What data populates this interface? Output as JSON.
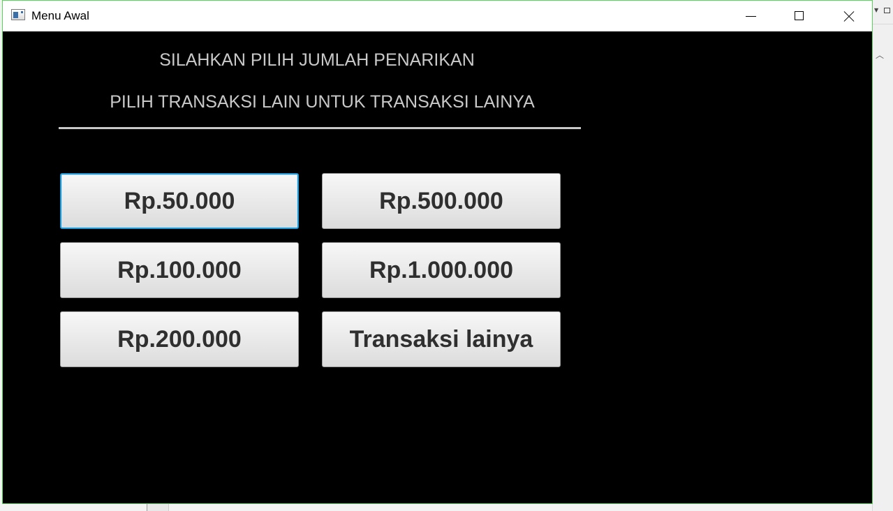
{
  "window": {
    "title": "Menu Awal"
  },
  "header": {
    "line1": "SILAHKAN PILIH JUMLAH PENARIKAN",
    "line2": "PILIH TRANSAKSI LAIN UNTUK TRANSAKSI LAINYA"
  },
  "buttons": [
    {
      "label": "Rp.50.000",
      "focused": true
    },
    {
      "label": "Rp.500.000"
    },
    {
      "label": "Rp.100.000"
    },
    {
      "label": "Rp.1.000.000"
    },
    {
      "label": "Rp.200.000"
    },
    {
      "label": "Transaksi lainya"
    }
  ],
  "colors": {
    "content_background": "#000000",
    "heading_text": "#c9c9c9",
    "focus_border": "#1f9ad6",
    "window_border": "#56d656"
  }
}
